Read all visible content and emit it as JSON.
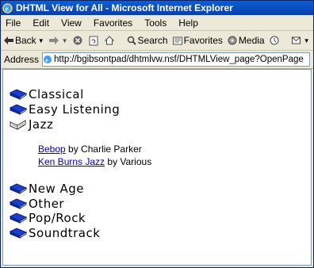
{
  "window": {
    "title": "DHTML View for All - Microsoft Internet Explorer"
  },
  "menu": [
    "File",
    "Edit",
    "View",
    "Favorites",
    "Tools",
    "Help"
  ],
  "toolbar": {
    "back": "Back",
    "search": "Search",
    "favorites": "Favorites",
    "media": "Media"
  },
  "address": {
    "label": "Address",
    "url": "http://bgibsontpad/dhtmlvw.nsf/DHTMLView_page?OpenPage"
  },
  "categories": [
    {
      "label": "Classical",
      "state": "collapsed"
    },
    {
      "label": "Easy Listening",
      "state": "collapsed"
    },
    {
      "label": "Jazz",
      "state": "expanded"
    },
    {
      "label": "New Age",
      "state": "collapsed"
    },
    {
      "label": "Other",
      "state": "collapsed"
    },
    {
      "label": "Pop/Rock",
      "state": "collapsed"
    },
    {
      "label": "Soundtrack",
      "state": "collapsed"
    }
  ],
  "jazz_docs": [
    {
      "title": "Bebop",
      "by": "by Charlie Parker"
    },
    {
      "title": "Ken Burns Jazz",
      "by": "by Various"
    }
  ],
  "colors": {
    "link": "#0000cc",
    "book": "#1a3fd0",
    "titlebar": "#0b4fc8"
  }
}
